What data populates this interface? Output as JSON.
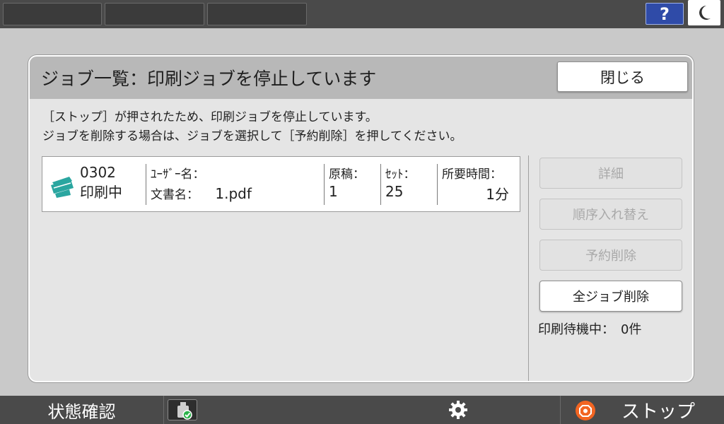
{
  "topbar": {
    "help_label": "?"
  },
  "dialog": {
    "title": "ジョブ一覧：印刷ジョブを停止しています",
    "close_label": "閉じる",
    "message_line1": "［ストップ］が押されたため、印刷ジョブを停止しています。",
    "message_line2": "ジョブを削除する場合は、ジョブを選択して［予約削除］を押してください。"
  },
  "job": {
    "number": "0302",
    "status": "印刷中",
    "user_label": "ﾕｰｻﾞｰ名：",
    "user_value": "",
    "doc_label": "文書名：",
    "doc_value": "1.pdf",
    "originals_label": "原稿：",
    "originals_value": "1",
    "sets_label": "ｾｯﾄ：",
    "sets_value": "25",
    "time_label": "所要時間：",
    "time_value": "1分"
  },
  "side_buttons": {
    "details": "詳細",
    "reorder": "順序入れ替え",
    "delete_reserved": "予約削除",
    "delete_all": "全ジョブ削除"
  },
  "queue_status": "印刷待機中：　0件",
  "bottombar": {
    "status_check": "状態確認",
    "stop": "ストップ"
  },
  "colors": {
    "accent_blue": "#2f4ba8",
    "printer_teal": "#2aa6a0",
    "stop_orange": "#f26522"
  }
}
